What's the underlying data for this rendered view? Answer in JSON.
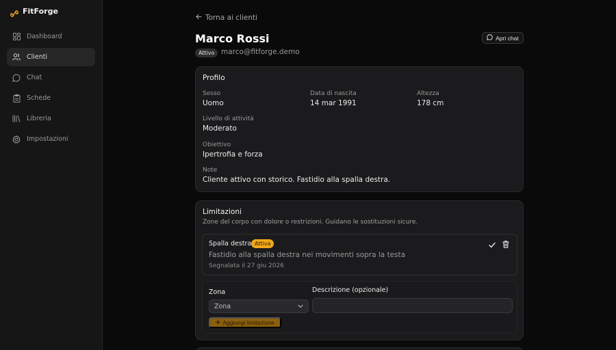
{
  "app": {
    "name": "FitForge"
  },
  "sidebar": {
    "items": [
      {
        "label": "Dashboard",
        "icon": "grid-icon",
        "active": false
      },
      {
        "label": "Clienti",
        "icon": "users-icon",
        "active": true
      },
      {
        "label": "Chat",
        "icon": "chat-bubble-icon",
        "active": false
      },
      {
        "label": "Schede",
        "icon": "clipboard-icon",
        "active": false
      },
      {
        "label": "Libreria",
        "icon": "library-icon",
        "active": false
      },
      {
        "label": "Impostazioni",
        "icon": "gear-icon",
        "active": false
      }
    ]
  },
  "header": {
    "back_label": "Torna ai clienti",
    "client_name": "Marco Rossi",
    "status": "Attivo",
    "email": "marco@fitforge.demo",
    "chat_button_label": "Apri chat"
  },
  "profile": {
    "title": "Profilo",
    "fields": {
      "sex": {
        "label": "Sesso",
        "value": "Uomo"
      },
      "birth_date": {
        "label": "Data di nascita",
        "value": "14 mar 1991"
      },
      "height": {
        "label": "Altezza",
        "value": "178 cm"
      },
      "activity_level": {
        "label": "Livello di attività",
        "value": "Moderato"
      },
      "goal": {
        "label": "Obiettivo",
        "value": "Ipertrofia e forza"
      },
      "notes": {
        "label": "Note",
        "value": "Cliente attivo con storico. Fastidio alla spalla destra."
      }
    }
  },
  "limitations": {
    "title": "Limitazioni",
    "subtitle": "Zone del corpo con dolore o restrizioni. Guidano le sostituzioni sicure.",
    "items": [
      {
        "name": "Spalla destra",
        "status": "Attiva",
        "description": "Fastidio alla spalla destra nei movimenti sopra la testa",
        "reported": "Segnalata il 27 giu 2026"
      }
    ],
    "form": {
      "zone_label": "Zona",
      "zone_value": "Zona",
      "description_label": "Descrizione (opzionale)",
      "description_value": "",
      "add_button_label": "Aggiungi limitazione"
    }
  },
  "colors": {
    "background": "#0a0a0a",
    "sidebar": "#161616",
    "card": "#1b1b1d",
    "accent": "#f0a81a",
    "accent_dark": "#8a5f0e"
  }
}
